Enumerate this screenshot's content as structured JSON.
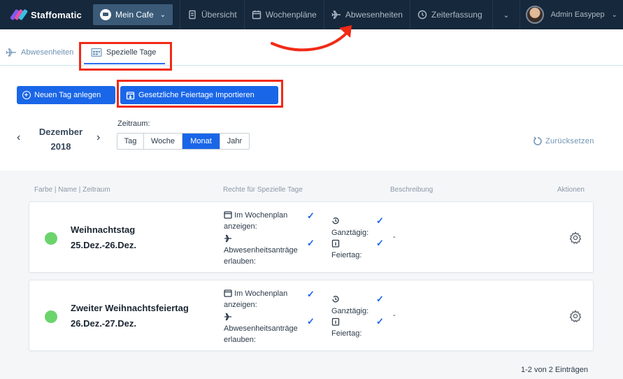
{
  "topbar": {
    "brand": "Staffomatic",
    "location_button": "Mein Cafe",
    "nav": [
      {
        "label": "Übersicht",
        "icon": "document-icon"
      },
      {
        "label": "Wochenpläne",
        "icon": "calendar-icon"
      },
      {
        "label": "Abwesenheiten",
        "icon": "plane-icon"
      },
      {
        "label": "Zeiterfassung",
        "icon": "clock-icon"
      }
    ],
    "user_name": "Admin Easypep"
  },
  "subtabs": [
    {
      "label": "Abwesenheiten",
      "icon": "plane-icon"
    },
    {
      "label": "Spezielle Tage",
      "icon": "calendar-grid-icon",
      "active": true
    }
  ],
  "actions": {
    "new_day": "Neuen Tag anlegen",
    "import_holidays": "Gesetzliche Feiertage Importieren"
  },
  "date_nav": {
    "month": "Dezember",
    "year": "2018"
  },
  "zeitraum": {
    "label": "Zeitraum:",
    "options": [
      "Tag",
      "Woche",
      "Monat",
      "Jahr"
    ],
    "selected": "Monat"
  },
  "reset_label": "Zurücksetzen",
  "columns": {
    "farbe_name": "Farbe | Name | Zeitraum",
    "rechte": "Rechte für Spezielle Tage",
    "beschreibung": "Beschreibung",
    "aktionen": "Aktionen"
  },
  "rows": [
    {
      "name": "Weihnachtstag",
      "range": "25.Dez.-26.Dez.",
      "color": "#6cd46c",
      "perm_wochenplan_1": "Im Wochenplan",
      "perm_wochenplan_2": "anzeigen:",
      "perm_abw_1": "Abwesenheitsanträge",
      "perm_abw_2": "erlauben:",
      "ganztaegig": "Ganztägig:",
      "feiertag": "Feiertag:",
      "description": "-"
    },
    {
      "name": "Zweiter Weihnachtsfeiertag",
      "range": "26.Dez.-27.Dez.",
      "color": "#6cd46c",
      "perm_wochenplan_1": "Im Wochenplan",
      "perm_wochenplan_2": "anzeigen:",
      "perm_abw_1": "Abwesenheitsanträge",
      "perm_abw_2": "erlauben:",
      "ganztaegig": "Ganztägig:",
      "feiertag": "Feiertag:",
      "description": "-"
    }
  ],
  "pager": "1-2 von 2 Einträgen",
  "colors": {
    "accent": "#1a66e8",
    "nav_bg": "#16283b",
    "highlight": "#f12a16"
  }
}
